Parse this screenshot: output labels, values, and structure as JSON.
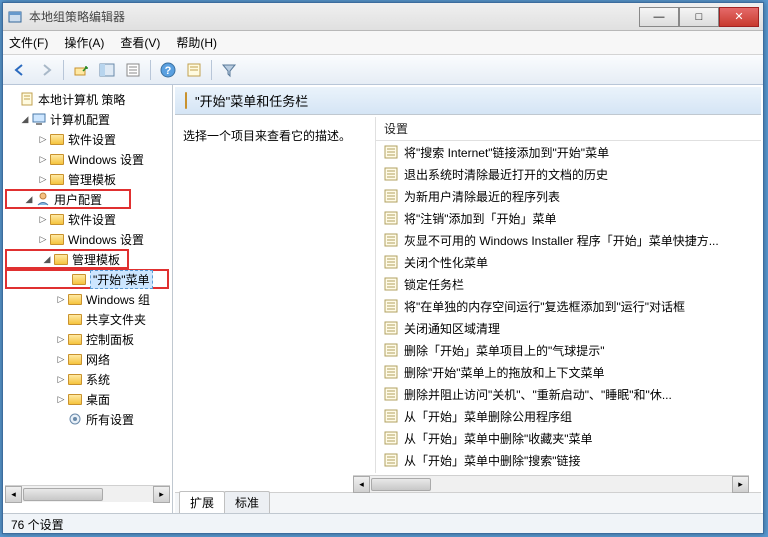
{
  "window": {
    "title": "本地组策略编辑器"
  },
  "menu": {
    "file": "文件(F)",
    "action": "操作(A)",
    "view": "查看(V)",
    "help": "帮助(H)"
  },
  "tree": {
    "root": "本地计算机 策略",
    "computer_config": "计算机配置",
    "cc_software": "软件设置",
    "cc_windows": "Windows 设置",
    "cc_admin": "管理模板",
    "user_config": "用户配置",
    "uc_software": "软件设置",
    "uc_windows": "Windows 设置",
    "uc_admin": "管理模板",
    "start_menu": "\"开始\"菜单",
    "windows_comp": "Windows 组",
    "shared_folders": "共享文件夹",
    "control_panel": "控制面板",
    "network": "网络",
    "system": "系统",
    "desktop": "桌面",
    "all_settings": "所有设置"
  },
  "content": {
    "header": "\"开始\"菜单和任务栏",
    "desc_prompt": "选择一个项目来查看它的描述。",
    "settings_col": "设置",
    "items": [
      "将\"搜索 Internet\"链接添加到\"开始\"菜单",
      "退出系统时清除最近打开的文档的历史",
      "为新用户清除最近的程序列表",
      "将\"注销\"添加到「开始」菜单",
      "灰显不可用的 Windows Installer 程序「开始」菜单快捷方...",
      "关闭个性化菜单",
      "锁定任务栏",
      "将\"在单独的内存空间运行\"复选框添加到\"运行\"对话框",
      "关闭通知区域清理",
      "删除「开始」菜单项目上的\"气球提示\"",
      "删除\"开始\"菜单上的拖放和上下文菜单",
      "删除并阻止访问\"关机\"、\"重新启动\"、\"睡眠\"和\"休...",
      "从「开始」菜单删除公用程序组",
      "从「开始」菜单中删除\"收藏夹\"菜单",
      "从「开始」菜单中删除\"搜索\"链接"
    ]
  },
  "tabs": {
    "extended": "扩展",
    "standard": "标准"
  },
  "status": "76 个设置"
}
